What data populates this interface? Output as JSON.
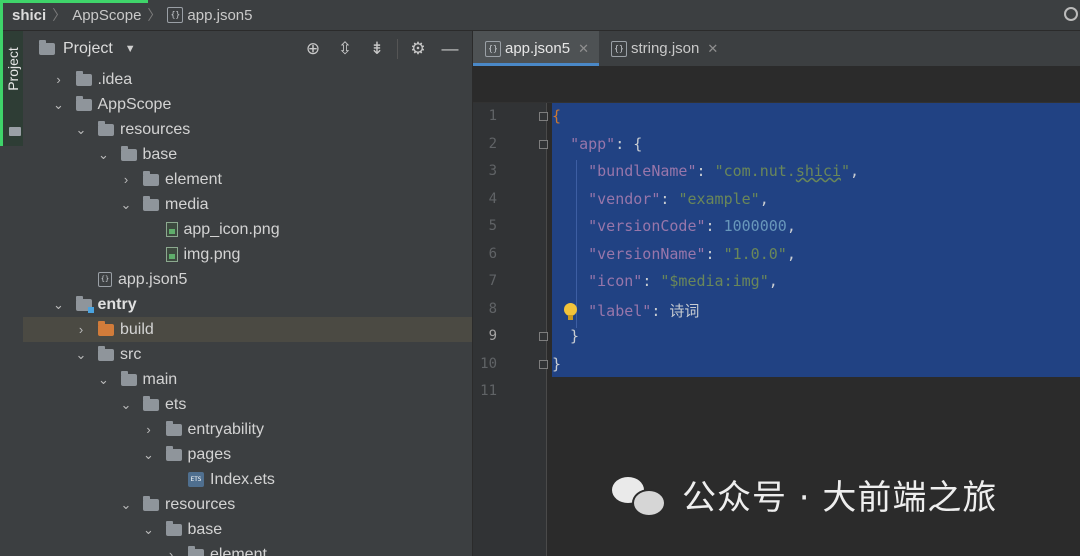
{
  "breadcrumb": {
    "project": "shici",
    "folder": "AppScope",
    "file": "app.json5"
  },
  "sidebar_tab": {
    "label": "Project"
  },
  "project_panel": {
    "title": "Project",
    "icons": [
      "crosshair-icon",
      "expand-all-icon",
      "collapse-all-icon",
      "gear-icon",
      "minimize-icon"
    ]
  },
  "tree": [
    {
      "label": ".idea",
      "indent": 1,
      "arrow": "right",
      "icon": "folder"
    },
    {
      "label": "AppScope",
      "indent": 1,
      "arrow": "down",
      "icon": "folder"
    },
    {
      "label": "resources",
      "indent": 2,
      "arrow": "down",
      "icon": "folder"
    },
    {
      "label": "base",
      "indent": 3,
      "arrow": "down",
      "icon": "folder"
    },
    {
      "label": "element",
      "indent": 4,
      "arrow": "right",
      "icon": "folder"
    },
    {
      "label": "media",
      "indent": 4,
      "arrow": "down",
      "icon": "folder"
    },
    {
      "label": "app_icon.png",
      "indent": 5,
      "arrow": "none",
      "icon": "image-file"
    },
    {
      "label": "img.png",
      "indent": 5,
      "arrow": "none",
      "icon": "image-file"
    },
    {
      "label": "app.json5",
      "indent": 2,
      "arrow": "none",
      "icon": "json-file"
    },
    {
      "label": "entry",
      "indent": 1,
      "arrow": "down",
      "icon": "module-folder",
      "bold": true
    },
    {
      "label": "build",
      "indent": 2,
      "arrow": "right",
      "icon": "orange-folder",
      "selected": true
    },
    {
      "label": "src",
      "indent": 2,
      "arrow": "down",
      "icon": "folder"
    },
    {
      "label": "main",
      "indent": 3,
      "arrow": "down",
      "icon": "folder"
    },
    {
      "label": "ets",
      "indent": 4,
      "arrow": "down",
      "icon": "folder"
    },
    {
      "label": "entryability",
      "indent": 5,
      "arrow": "right",
      "icon": "folder"
    },
    {
      "label": "pages",
      "indent": 5,
      "arrow": "down",
      "icon": "folder"
    },
    {
      "label": "Index.ets",
      "indent": 6,
      "arrow": "none",
      "icon": "ets-file"
    },
    {
      "label": "resources",
      "indent": 4,
      "arrow": "down",
      "icon": "folder"
    },
    {
      "label": "base",
      "indent": 5,
      "arrow": "down",
      "icon": "folder"
    },
    {
      "label": "element",
      "indent": 6,
      "arrow": "right",
      "icon": "folder"
    }
  ],
  "tabs": [
    {
      "label": "app.json5",
      "active": true
    },
    {
      "label": "string.json",
      "active": false
    }
  ],
  "editor": {
    "line_numbers": [
      "1",
      "2",
      "3",
      "4",
      "5",
      "6",
      "7",
      "8",
      "9",
      "10",
      "11"
    ],
    "current_line": "9",
    "lines": [
      {
        "parts": [
          [
            "p",
            "{"
          ]
        ]
      },
      {
        "parts": [
          [
            "t",
            "  "
          ],
          [
            "k",
            "\"app\""
          ],
          [
            "t",
            ": {"
          ]
        ]
      },
      {
        "parts": [
          [
            "t",
            "    "
          ],
          [
            "k",
            "\"bundleName\""
          ],
          [
            "t",
            ": "
          ],
          [
            "s",
            "\"com.nut.shici\""
          ],
          [
            "t",
            ","
          ]
        ]
      },
      {
        "parts": [
          [
            "t",
            "    "
          ],
          [
            "k",
            "\"vendor\""
          ],
          [
            "t",
            ": "
          ],
          [
            "s",
            "\"example\""
          ],
          [
            "t",
            ","
          ]
        ]
      },
      {
        "parts": [
          [
            "t",
            "    "
          ],
          [
            "k",
            "\"versionCode\""
          ],
          [
            "t",
            ": "
          ],
          [
            "n",
            "1000000"
          ],
          [
            "t",
            ","
          ]
        ]
      },
      {
        "parts": [
          [
            "t",
            "    "
          ],
          [
            "k",
            "\"versionName\""
          ],
          [
            "t",
            ": "
          ],
          [
            "s",
            "\"1.0.0\""
          ],
          [
            "t",
            ","
          ]
        ]
      },
      {
        "parts": [
          [
            "t",
            "    "
          ],
          [
            "k",
            "\"icon\""
          ],
          [
            "t",
            ": "
          ],
          [
            "s",
            "\"$media:img\""
          ],
          [
            "t",
            ","
          ]
        ]
      },
      {
        "parts": [
          [
            "t",
            "    "
          ],
          [
            "k",
            "\"label\""
          ],
          [
            "t",
            ": 诗词"
          ]
        ]
      },
      {
        "parts": [
          [
            "t",
            "  }"
          ]
        ]
      },
      {
        "parts": [
          [
            "t",
            "}"
          ]
        ]
      },
      {
        "parts": [
          [
            "t",
            ""
          ]
        ]
      }
    ]
  },
  "watermark": {
    "text": "公众号 · 大前端之旅"
  }
}
